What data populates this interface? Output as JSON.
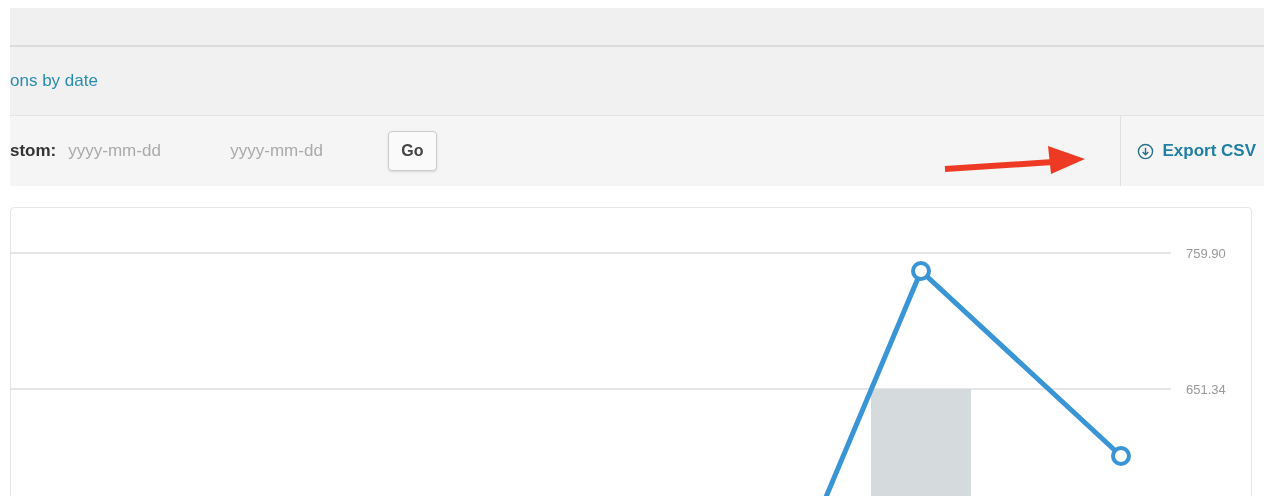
{
  "section_link": "ons by date",
  "filter_bar": {
    "label": "stom:",
    "start_date": {
      "placeholder": "yyyy-mm-dd"
    },
    "end_date": {
      "placeholder": "yyyy-mm-dd"
    },
    "go_button": "Go",
    "export_button": "Export CSV"
  },
  "chart": {
    "y_axis_labels": [
      "759.90",
      "651.34"
    ]
  }
}
